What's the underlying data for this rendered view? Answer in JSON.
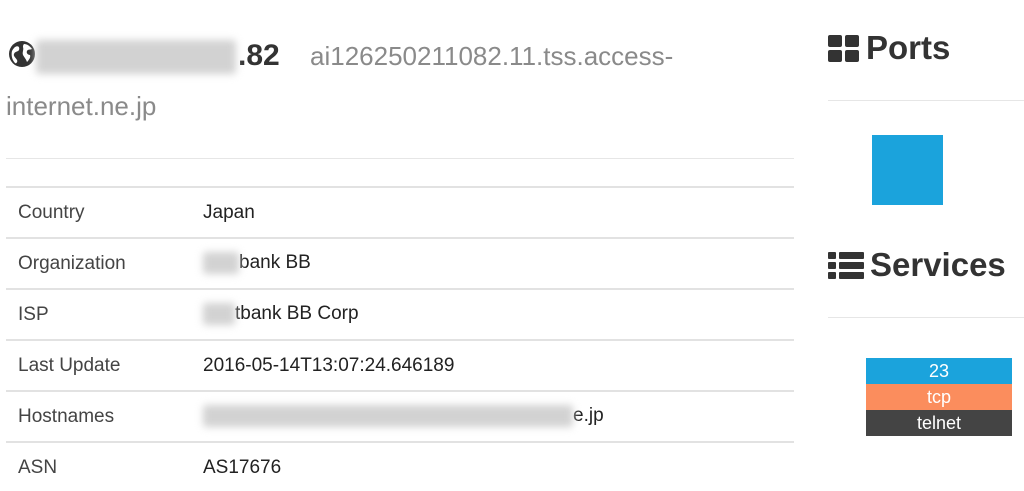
{
  "header": {
    "ip_suffix": ".82",
    "hostname_line1": "ai126250211082.11.tss.access-",
    "hostname_line2": "internet.ne.jp"
  },
  "details": [
    {
      "key": "Country",
      "value": "Japan"
    },
    {
      "key": "Organization",
      "value": "bank BB"
    },
    {
      "key": "ISP",
      "value": "tbank BB Corp"
    },
    {
      "key": "Last Update",
      "value": "2016-05-14T13:07:24.646189"
    },
    {
      "key": "Hostnames",
      "value": "e.jp"
    },
    {
      "key": "ASN",
      "value": "AS17676"
    }
  ],
  "ports": {
    "title": "Ports",
    "icon": "grid-icon",
    "color": "#1ba3dc"
  },
  "services": {
    "title": "Services",
    "icon": "list-icon",
    "items": [
      {
        "port": "23",
        "protocol": "tcp",
        "name": "telnet"
      }
    ],
    "colors": {
      "port": "#1ba3dc",
      "protocol": "#fb8d5d",
      "name": "#444444"
    }
  }
}
